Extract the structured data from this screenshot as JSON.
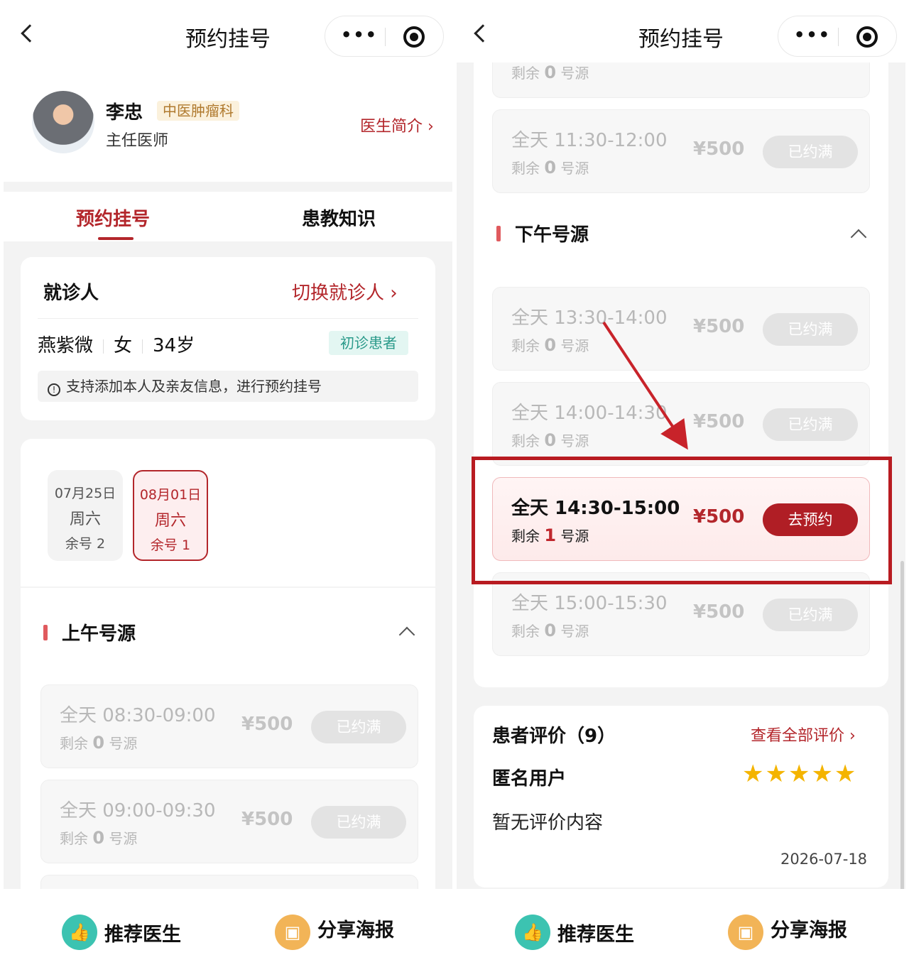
{
  "nav": {
    "title": "预约挂号"
  },
  "doctor": {
    "name": "李忠",
    "department": "中医肿瘤科",
    "title": "主任医师",
    "intro_link": "医生简介 ›"
  },
  "tabs": [
    {
      "label": "预约挂号",
      "active": true
    },
    {
      "label": "患教知识",
      "active": false
    }
  ],
  "patient": {
    "label": "就诊人",
    "switch_link": "切换就诊人 ›",
    "name": "燕紫微",
    "gender": "女",
    "age": "34岁",
    "badge": "初诊患者",
    "notice": "支持添加本人及亲友信息，进行预约挂号"
  },
  "dates": [
    {
      "date": "07月25日",
      "weekday": "周六",
      "remaining": "余号 2",
      "selected": false
    },
    {
      "date": "08月01日",
      "weekday": "周六",
      "remaining": "余号 1",
      "selected": true
    }
  ],
  "morning": {
    "title": "上午号源",
    "slots": [
      {
        "time": "全天 08:30-09:00",
        "remain_prefix": "剩余",
        "remain_count": "0",
        "remain_suffix": "号源",
        "price": "¥500",
        "button": "已约满"
      },
      {
        "time": "全天 09:00-09:30",
        "remain_prefix": "剩余",
        "remain_count": "0",
        "remain_suffix": "号源",
        "price": "¥500",
        "button": "已约满"
      }
    ]
  },
  "right_top_partial": {
    "remain_prefix": "剩余",
    "remain_count": "0",
    "remain_suffix": "号源"
  },
  "right_morning_last": {
    "time": "全天 11:30-12:00",
    "remain_prefix": "剩余",
    "remain_count": "0",
    "remain_suffix": "号源",
    "price": "¥500",
    "button": "已约满"
  },
  "afternoon": {
    "title": "下午号源",
    "slots": [
      {
        "time": "全天 13:30-14:00",
        "remain_prefix": "剩余",
        "remain_count": "0",
        "remain_suffix": "号源",
        "price": "¥500",
        "button": "已约满"
      },
      {
        "time": "全天 14:00-14:30",
        "remain_prefix": "剩余",
        "remain_count": "0",
        "remain_suffix": "号源",
        "price": "¥500",
        "button": "已约满"
      },
      {
        "time": "全天 14:30-15:00",
        "remain_prefix": "剩余",
        "remain_count": "1",
        "remain_suffix": "号源",
        "price": "¥500",
        "button": "去预约"
      },
      {
        "time": "全天 15:00-15:30",
        "remain_prefix": "剩余",
        "remain_count": "0",
        "remain_suffix": "号源",
        "price": "¥500",
        "button": "已约满"
      }
    ]
  },
  "reviews": {
    "title": "患者评价（9）",
    "view_all": "查看全部评价 ›",
    "user": "匿名用户",
    "stars": "★★★★★",
    "text": "暂无评价内容",
    "date": "2026-07-18"
  },
  "bottom": {
    "recommend": "推荐医生",
    "share": "分享海报"
  },
  "colors": {
    "brand": "#b3262b",
    "accent_teal": "#3cc3b1",
    "accent_orange": "#f2b457",
    "highlight": "#b81b21"
  }
}
